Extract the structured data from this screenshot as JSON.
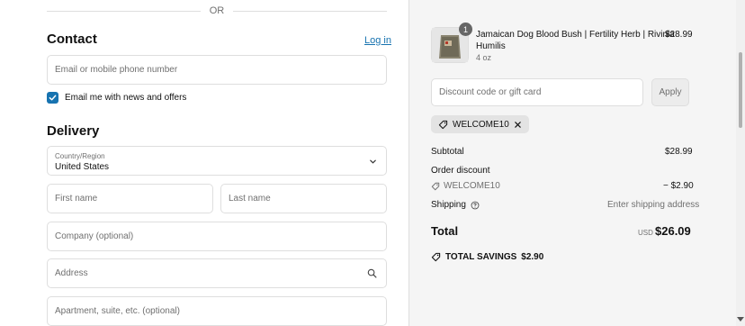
{
  "divider": {
    "or_label": "OR"
  },
  "contact": {
    "heading": "Contact",
    "login_link": "Log in",
    "email_placeholder": "Email or mobile phone number",
    "news_label": "Email me with news and offers",
    "news_checked": true
  },
  "delivery": {
    "heading": "Delivery",
    "country_label": "Country/Region",
    "country_value": "United States",
    "first_name_placeholder": "First name",
    "last_name_placeholder": "Last name",
    "company_placeholder": "Company (optional)",
    "address_placeholder": "Address",
    "apartment_placeholder": "Apartment, suite, etc. (optional)"
  },
  "summary": {
    "product": {
      "quantity": "1",
      "name_line1": "Jamaican Dog Blood Bush | Fertility Herb | Rivinia",
      "name_line2": "Humilis",
      "variant": "4 oz",
      "price": "$28.99"
    },
    "discount_placeholder": "Discount code or gift card",
    "apply_label": "Apply",
    "applied_code": "WELCOME10",
    "subtotal_label": "Subtotal",
    "subtotal_value": "$28.99",
    "order_discount_label": "Order discount",
    "discount_code": "WELCOME10",
    "discount_value": "− $2.90",
    "shipping_label": "Shipping",
    "shipping_value": "Enter shipping address",
    "total_label": "Total",
    "currency": "USD",
    "total_value": "$26.09",
    "savings_label": "TOTAL SAVINGS",
    "savings_value": "$2.90"
  },
  "colors": {
    "accent": "#1773b0",
    "summary_bg": "#f5f5f5",
    "border": "#dedede"
  },
  "icons": [
    "checkmark-icon",
    "chevron-down-icon",
    "search-icon",
    "tag-icon",
    "close-icon",
    "help-circle-icon"
  ]
}
